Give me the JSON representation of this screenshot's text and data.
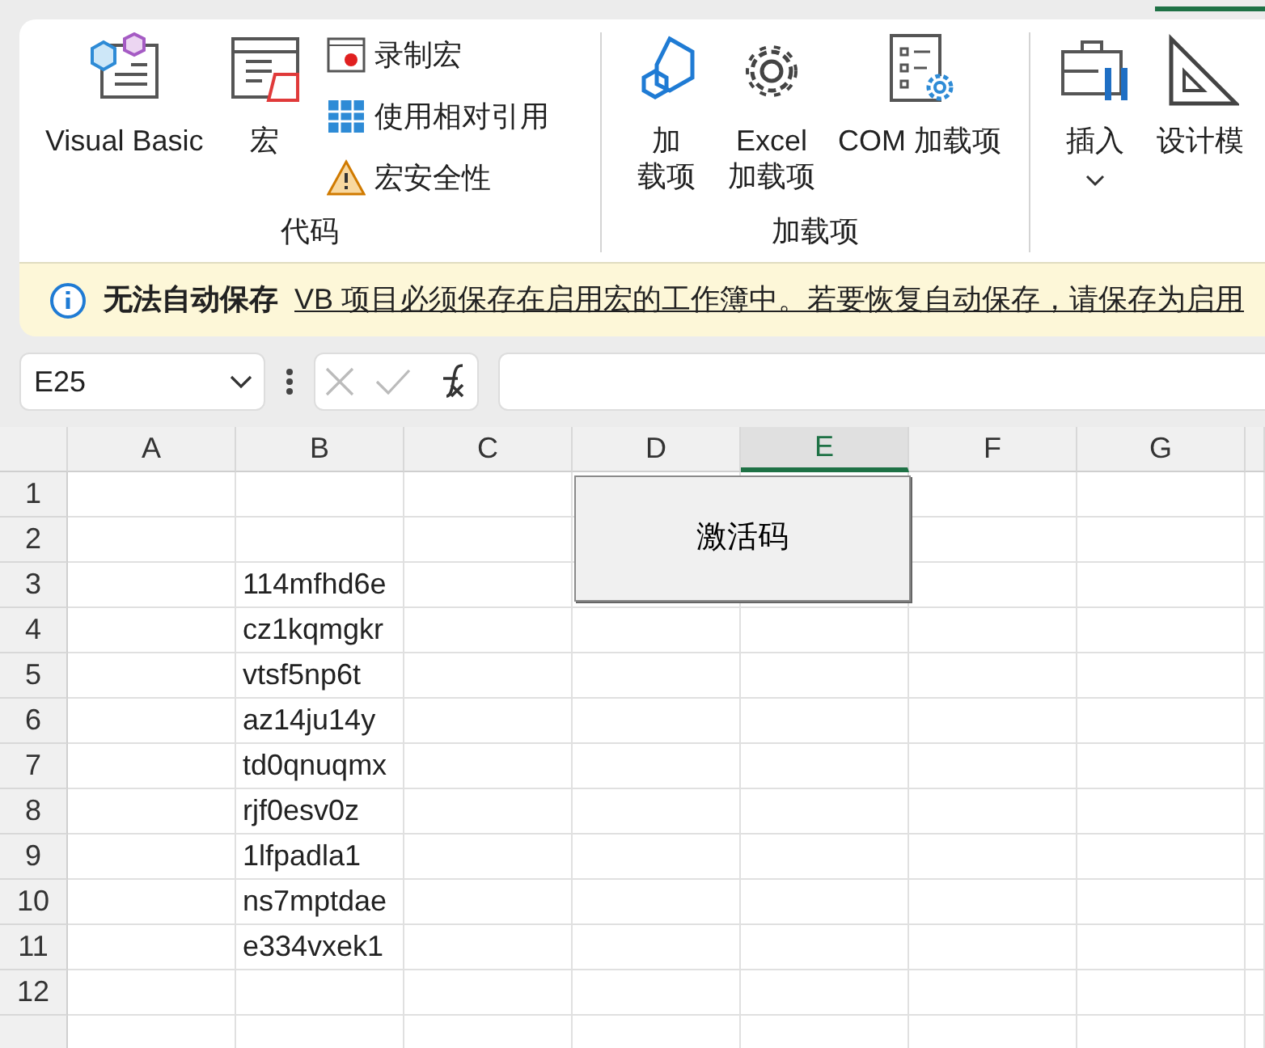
{
  "ribbon": {
    "groups": [
      {
        "label": "代码",
        "large_buttons": [
          {
            "lines": [
              "Visual Basic"
            ]
          },
          {
            "lines": [
              "宏"
            ]
          }
        ],
        "small_buttons": [
          {
            "label": "录制宏"
          },
          {
            "label": "使用相对引用"
          },
          {
            "label": "宏安全性"
          }
        ]
      },
      {
        "label": "加载项",
        "large_buttons": [
          {
            "lines": [
              "加",
              "载项"
            ]
          },
          {
            "lines": [
              "Excel",
              "加载项"
            ]
          },
          {
            "lines": [
              "COM 加载项"
            ]
          }
        ]
      },
      {
        "large_buttons": [
          {
            "lines": [
              "插入"
            ],
            "dropdown": true
          },
          {
            "lines": [
              "设计模"
            ]
          }
        ]
      }
    ]
  },
  "info_bar": {
    "title": "无法自动保存",
    "message": "VB 项目必须保存在启用宏的工作簿中。若要恢复自动保存，请保存为启用"
  },
  "formula_bar": {
    "name_box": "E25"
  },
  "sheet": {
    "columns": [
      {
        "label": "A",
        "selected": false
      },
      {
        "label": "B",
        "selected": false
      },
      {
        "label": "C",
        "selected": false
      },
      {
        "label": "D",
        "selected": false
      },
      {
        "label": "E",
        "selected": true
      },
      {
        "label": "F",
        "selected": false
      },
      {
        "label": "G",
        "selected": false
      }
    ],
    "rows": [
      {
        "number": "1",
        "cells": {}
      },
      {
        "number": "2",
        "cells": {}
      },
      {
        "number": "3",
        "cells": {
          "B": "114mfhd6e"
        }
      },
      {
        "number": "4",
        "cells": {
          "B": "cz1kqmgkr"
        }
      },
      {
        "number": "5",
        "cells": {
          "B": "vtsf5np6t"
        }
      },
      {
        "number": "6",
        "cells": {
          "B": "az14ju14y"
        }
      },
      {
        "number": "7",
        "cells": {
          "B": "td0qnuqmx"
        }
      },
      {
        "number": "8",
        "cells": {
          "B": "rjf0esv0z"
        }
      },
      {
        "number": "9",
        "cells": {
          "B": "1lfpadla1"
        }
      },
      {
        "number": "10",
        "cells": {
          "B": "ns7mptdae"
        }
      },
      {
        "number": "11",
        "cells": {
          "B": "e334vxek1"
        }
      },
      {
        "number": "12",
        "cells": {}
      }
    ],
    "button": {
      "label": "激活码"
    }
  }
}
